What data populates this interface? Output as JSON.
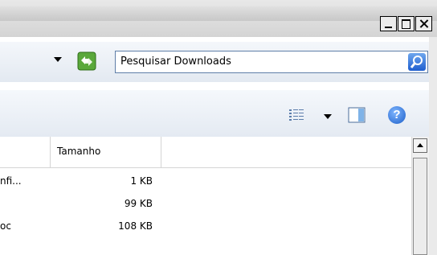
{
  "window": {
    "controls": [
      "minimize",
      "maximize",
      "close"
    ]
  },
  "address": {
    "search_placeholder": "Pesquisar Downloads"
  },
  "toolbar": {
    "icons": [
      "views-icon",
      "preview-pane-icon",
      "help-icon"
    ],
    "help_glyph": "?"
  },
  "file_list": {
    "columns": [
      "Tamanho"
    ],
    "rows": [
      {
        "name": "nfi...",
        "size": "1 KB"
      },
      {
        "name": "",
        "size": "99 KB"
      },
      {
        "name": "oc",
        "size": "108 KB"
      }
    ]
  }
}
